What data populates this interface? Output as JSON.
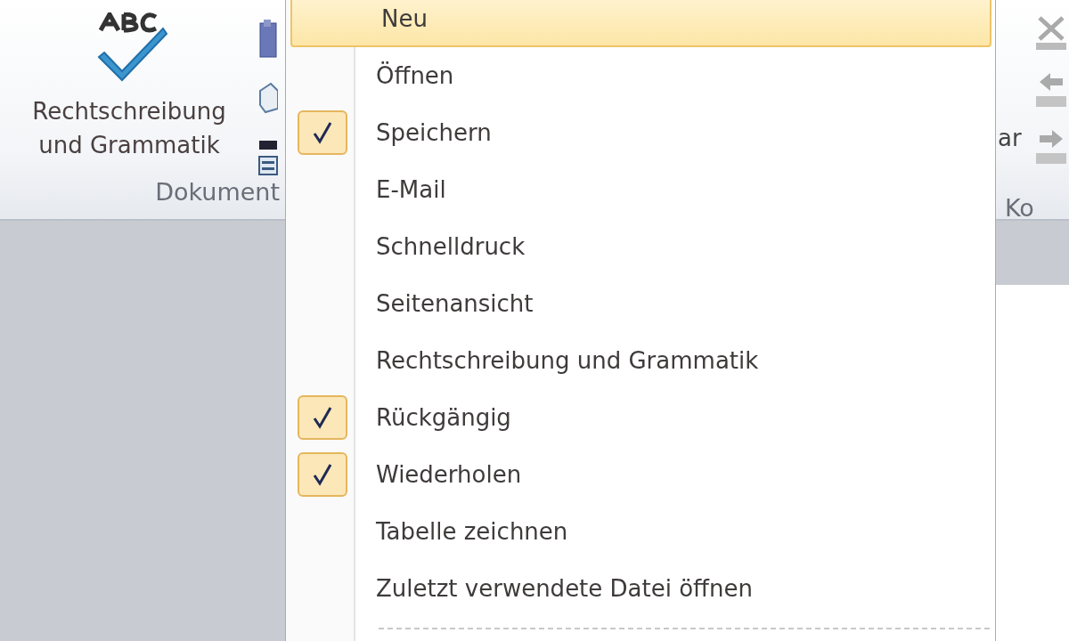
{
  "ribbon": {
    "spelling_button": {
      "label_lines": [
        "Rechtschreibung",
        "und Grammatik"
      ]
    },
    "group_label": "Dokument",
    "right_partial_label": "ar",
    "right_group_label": "Ko"
  },
  "menu": {
    "items": [
      {
        "label": "Neu",
        "checked": false,
        "selected": true
      },
      {
        "label": "Öffnen",
        "checked": false,
        "selected": false
      },
      {
        "label": "Speichern",
        "checked": true,
        "selected": false
      },
      {
        "label": "E-Mail",
        "checked": false,
        "selected": false
      },
      {
        "label": "Schnelldruck",
        "checked": false,
        "selected": false
      },
      {
        "label": "Seitenansicht",
        "checked": false,
        "selected": false
      },
      {
        "label": "Rechtschreibung und Grammatik",
        "checked": false,
        "selected": false
      },
      {
        "label": "Rückgängig",
        "checked": true,
        "selected": false
      },
      {
        "label": "Wiederholen",
        "checked": true,
        "selected": false
      },
      {
        "label": "Tabelle zeichnen",
        "checked": false,
        "selected": false
      },
      {
        "label": "Zuletzt verwendete Datei öffnen",
        "checked": false,
        "selected": false
      }
    ]
  }
}
